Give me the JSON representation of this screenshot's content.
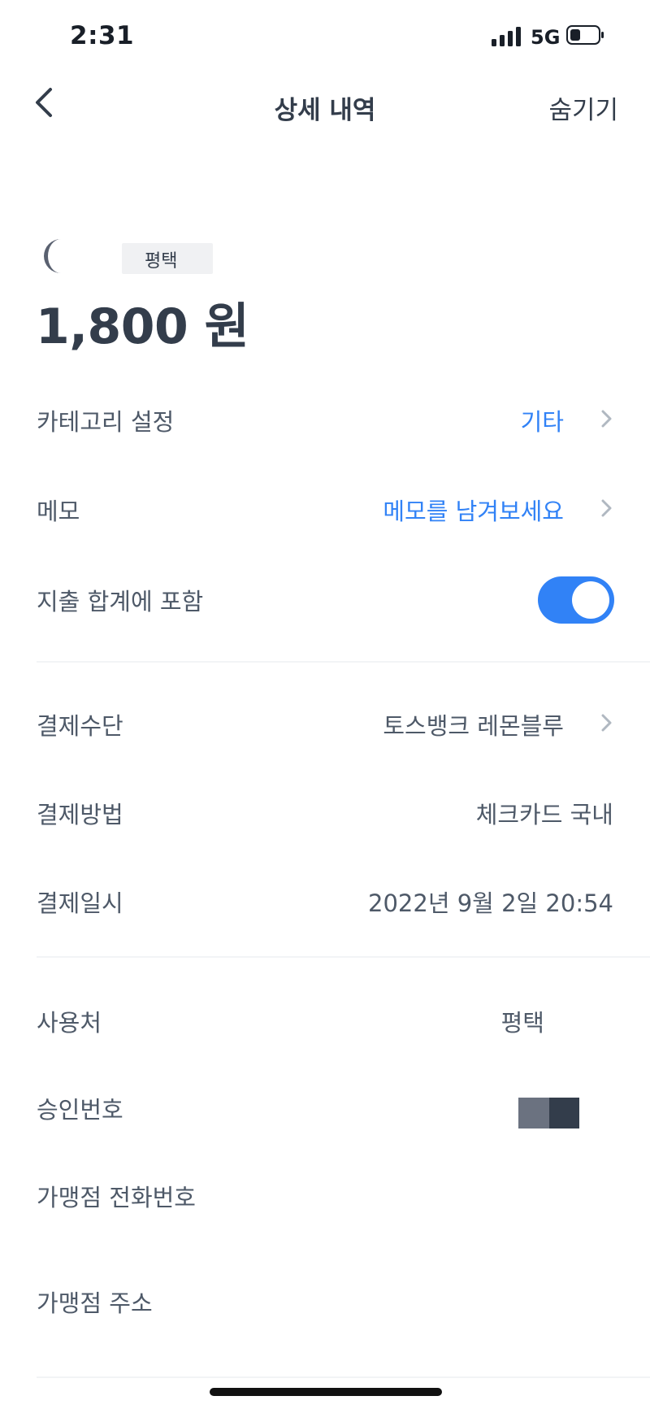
{
  "status_bar": {
    "time": "2:31",
    "network": "5G"
  },
  "nav": {
    "title": "상세 내역",
    "hide_label": "숨기기"
  },
  "transaction": {
    "merchant_short": "평택",
    "amount": "1,800 원"
  },
  "rows": {
    "category": {
      "label": "카테고리 설정",
      "value": "기타"
    },
    "memo": {
      "label": "메모",
      "placeholder": "메모를 남겨보세요"
    },
    "include_total": {
      "label": "지출 합계에 포함",
      "enabled": true
    },
    "payment_method": {
      "label": "결제수단",
      "value": "토스뱅크 레몬블루"
    },
    "payment_type": {
      "label": "결제방법",
      "value": "체크카드 국내"
    },
    "payment_date": {
      "label": "결제일시",
      "value": "2022년 9월 2일 20:54"
    },
    "merchant": {
      "label": "사용처",
      "value": "평택"
    },
    "approval": {
      "label": "승인번호"
    },
    "merchant_phone": {
      "label": "가맹점 전화번호"
    },
    "merchant_address": {
      "label": "가맹점 주소"
    }
  },
  "colors": {
    "accent": "#3182f6",
    "text": "#4e5968",
    "title": "#333d4b"
  },
  "icons": [
    "signal-icon",
    "battery-icon",
    "back-chevron-icon",
    "chevron-right-icon"
  ]
}
